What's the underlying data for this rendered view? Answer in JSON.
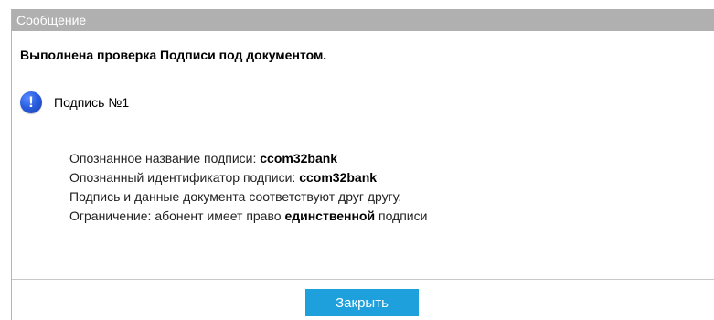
{
  "dialog": {
    "title": "Сообщение",
    "message": "Выполнена проверка Подписи под документом.",
    "signature": {
      "icon": "info-icon",
      "label": "Подпись №1"
    },
    "details": {
      "recognized_name_label": "Опознанное название подписи: ",
      "recognized_name_value": "ccom32bank",
      "recognized_id_label": "Опознанный идентификатор подписи: ",
      "recognized_id_value": "ccom32bank",
      "match_text": "Подпись и данные документа соответствуют друг другу.",
      "restriction_prefix": "Ограничение: абонент имеет право ",
      "restriction_bold": "единственной",
      "restriction_suffix": " подписи"
    },
    "close_label": "Закрыть",
    "colors": {
      "titlebar": "#b0b0b0",
      "button": "#1da0dc",
      "icon": "#2a5fe0"
    }
  }
}
